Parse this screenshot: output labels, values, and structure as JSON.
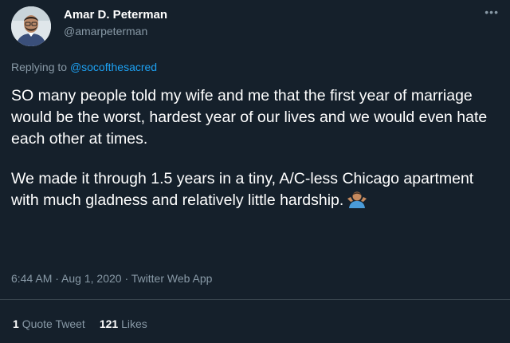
{
  "author": {
    "name": "Amar D. Peterman",
    "handle": "@amarpeterman"
  },
  "more_icon": "more-horizontal-icon",
  "reply": {
    "prefix": "Replying to ",
    "mention": "@socofthesacred"
  },
  "tweet": {
    "paragraph1": "SO many people told my wife and me that the first year of marriage would be the worst, hardest year of our lives and we would even hate each other at times.",
    "paragraph2": "We made it through 1.5 years in a tiny, A/C-less Chicago apartment with much gladness and relatively little hardship.",
    "emoji": "person-shrugging-emoji"
  },
  "meta": {
    "time": "6:44 AM",
    "sep1": " · ",
    "date": "Aug 1, 2020",
    "sep2": " · ",
    "source": "Twitter Web App"
  },
  "stats": {
    "quote_count": "1",
    "quote_label": "Quote Tweet",
    "like_count": "121",
    "like_label": "Likes"
  },
  "colors": {
    "background": "#15202b",
    "secondary_text": "#8899a6",
    "link": "#1da1f2",
    "divider": "#38444d"
  }
}
